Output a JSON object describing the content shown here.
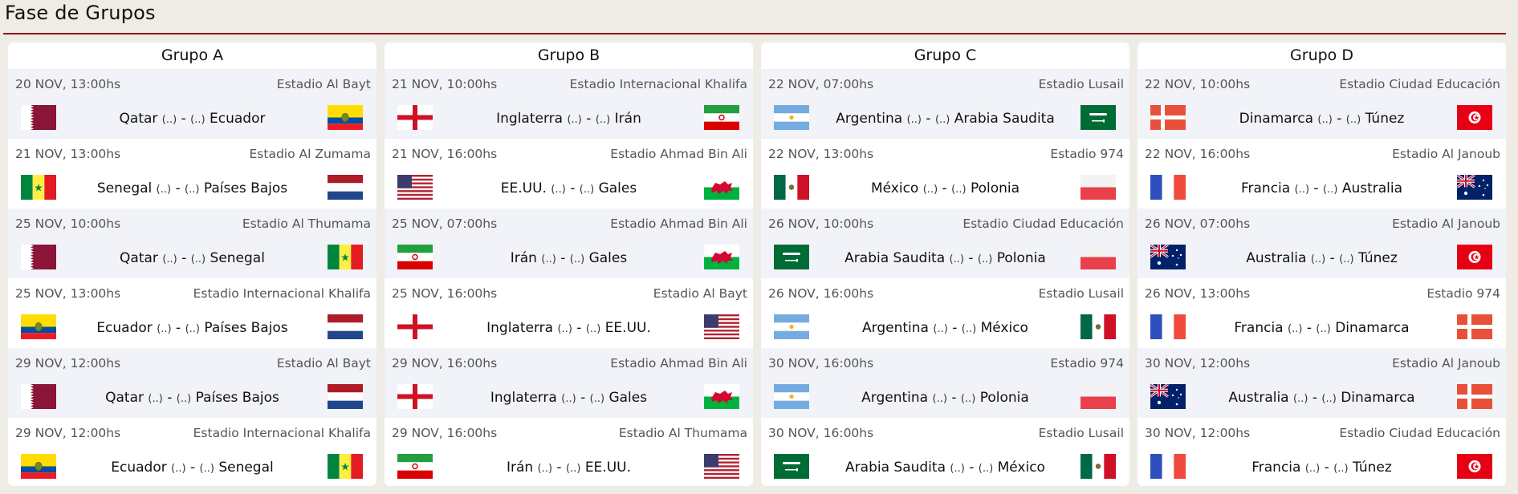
{
  "section_title": "Fase de Grupos",
  "colors": {
    "accent_rule": "#8c1a1a",
    "page_bg": "#eeece4",
    "alt_row": "#f1f3f9"
  },
  "groups": [
    {
      "title": "Grupo A",
      "matches": [
        {
          "date": "20 NOV, 13:00hs",
          "venue": "Estadio Al Bayt",
          "home": "Qatar",
          "away": "Ecuador",
          "home_score": "(..)",
          "away_score": "(..)",
          "home_flag": "qatar-flag-icon",
          "away_flag": "ecuador-flag-icon"
        },
        {
          "date": "21 NOV, 13:00hs",
          "venue": "Estadio Al Zumama",
          "home": "Senegal",
          "away": "Países Bajos",
          "home_score": "(..)",
          "away_score": "(..)",
          "home_flag": "senegal-flag-icon",
          "away_flag": "netherlands-flag-icon"
        },
        {
          "date": "25 NOV, 10:00hs",
          "venue": "Estadio Al Thumama",
          "home": "Qatar",
          "away": "Senegal",
          "home_score": "(..)",
          "away_score": "(..)",
          "home_flag": "qatar-flag-icon",
          "away_flag": "senegal-flag-icon"
        },
        {
          "date": "25 NOV, 13:00hs",
          "venue": "Estadio Internacional Khalifa",
          "home": "Ecuador",
          "away": "Países Bajos",
          "home_score": "(..)",
          "away_score": "(..)",
          "home_flag": "ecuador-flag-icon",
          "away_flag": "netherlands-flag-icon"
        },
        {
          "date": "29 NOV, 12:00hs",
          "venue": "Estadio Al Bayt",
          "home": "Qatar",
          "away": "Países Bajos",
          "home_score": "(..)",
          "away_score": "(..)",
          "home_flag": "qatar-flag-icon",
          "away_flag": "netherlands-flag-icon"
        },
        {
          "date": "29 NOV, 12:00hs",
          "venue": "Estadio Internacional Khalifa",
          "home": "Ecuador",
          "away": "Senegal",
          "home_score": "(..)",
          "away_score": "(..)",
          "home_flag": "ecuador-flag-icon",
          "away_flag": "senegal-flag-icon"
        }
      ]
    },
    {
      "title": "Grupo B",
      "matches": [
        {
          "date": "21 NOV, 10:00hs",
          "venue": "Estadio Internacional Khalifa",
          "home": "Inglaterra",
          "away": "Irán",
          "home_score": "(..)",
          "away_score": "(..)",
          "home_flag": "england-flag-icon",
          "away_flag": "iran-flag-icon"
        },
        {
          "date": "21 NOV, 16:00hs",
          "venue": "Estadio Ahmad Bin Ali",
          "home": "EE.UU.",
          "away": "Gales",
          "home_score": "(..)",
          "away_score": "(..)",
          "home_flag": "usa-flag-icon",
          "away_flag": "wales-flag-icon"
        },
        {
          "date": "25 NOV, 07:00hs",
          "venue": "Estadio Ahmad Bin Ali",
          "home": "Irán",
          "away": "Gales",
          "home_score": "(..)",
          "away_score": "(..)",
          "home_flag": "iran-flag-icon",
          "away_flag": "wales-flag-icon"
        },
        {
          "date": "25 NOV, 16:00hs",
          "venue": "Estadio Al Bayt",
          "home": "Inglaterra",
          "away": "EE.UU.",
          "home_score": "(..)",
          "away_score": "(..)",
          "home_flag": "england-flag-icon",
          "away_flag": "usa-flag-icon"
        },
        {
          "date": "29 NOV, 16:00hs",
          "venue": "Estadio Ahmad Bin Ali",
          "home": "Inglaterra",
          "away": "Gales",
          "home_score": "(..)",
          "away_score": "(..)",
          "home_flag": "england-flag-icon",
          "away_flag": "wales-flag-icon"
        },
        {
          "date": "29 NOV, 16:00hs",
          "venue": "Estadio Al Thumama",
          "home": "Irán",
          "away": "EE.UU.",
          "home_score": "(..)",
          "away_score": "(..)",
          "home_flag": "iran-flag-icon",
          "away_flag": "usa-flag-icon"
        }
      ]
    },
    {
      "title": "Grupo C",
      "matches": [
        {
          "date": "22 NOV, 07:00hs",
          "venue": "Estadio Lusail",
          "home": "Argentina",
          "away": "Arabia Saudita",
          "home_score": "(..)",
          "away_score": "(..)",
          "home_flag": "argentina-flag-icon",
          "away_flag": "saudi-arabia-flag-icon"
        },
        {
          "date": "22 NOV, 13:00hs",
          "venue": "Estadio 974",
          "home": "México",
          "away": "Polonia",
          "home_score": "(..)",
          "away_score": "(..)",
          "home_flag": "mexico-flag-icon",
          "away_flag": "poland-flag-icon"
        },
        {
          "date": "26 NOV, 10:00hs",
          "venue": "Estadio Ciudad Educación",
          "home": "Arabia Saudita",
          "away": "Polonia",
          "home_score": "(..)",
          "away_score": "(..)",
          "home_flag": "saudi-arabia-flag-icon",
          "away_flag": "poland-flag-icon"
        },
        {
          "date": "26 NOV, 16:00hs",
          "venue": "Estadio Lusail",
          "home": "Argentina",
          "away": "México",
          "home_score": "(..)",
          "away_score": "(..)",
          "home_flag": "argentina-flag-icon",
          "away_flag": "mexico-flag-icon"
        },
        {
          "date": "30 NOV, 16:00hs",
          "venue": "Estadio 974",
          "home": "Argentina",
          "away": "Polonia",
          "home_score": "(..)",
          "away_score": "(..)",
          "home_flag": "argentina-flag-icon",
          "away_flag": "poland-flag-icon"
        },
        {
          "date": "30 NOV, 16:00hs",
          "venue": "Estadio Lusail",
          "home": "Arabia Saudita",
          "away": "México",
          "home_score": "(..)",
          "away_score": "(..)",
          "home_flag": "saudi-arabia-flag-icon",
          "away_flag": "mexico-flag-icon"
        }
      ]
    },
    {
      "title": "Grupo D",
      "matches": [
        {
          "date": "22 NOV, 10:00hs",
          "venue": "Estadio Ciudad Educación",
          "home": "Dinamarca",
          "away": "Túnez",
          "home_score": "(..)",
          "away_score": "(..)",
          "home_flag": "denmark-flag-icon",
          "away_flag": "tunisia-flag-icon"
        },
        {
          "date": "22 NOV, 16:00hs",
          "venue": "Estadio Al Janoub",
          "home": "Francia",
          "away": "Australia",
          "home_score": "(..)",
          "away_score": "(..)",
          "home_flag": "france-flag-icon",
          "away_flag": "australia-flag-icon"
        },
        {
          "date": "26 NOV, 07:00hs",
          "venue": "Estadio Al Janoub",
          "home": "Australia",
          "away": "Túnez",
          "home_score": "(..)",
          "away_score": "(..)",
          "home_flag": "australia-flag-icon",
          "away_flag": "tunisia-flag-icon"
        },
        {
          "date": "26 NOV, 13:00hs",
          "venue": "Estadio 974",
          "home": "Francia",
          "away": "Dinamarca",
          "home_score": "(..)",
          "away_score": "(..)",
          "home_flag": "france-flag-icon",
          "away_flag": "denmark-flag-icon"
        },
        {
          "date": "30 NOV, 12:00hs",
          "venue": "Estadio Al Janoub",
          "home": "Australia",
          "away": "Dinamarca",
          "home_score": "(..)",
          "away_score": "(..)",
          "home_flag": "australia-flag-icon",
          "away_flag": "denmark-flag-icon"
        },
        {
          "date": "30 NOV, 12:00hs",
          "venue": "Estadio Ciudad Educación",
          "home": "Francia",
          "away": "Túnez",
          "home_score": "(..)",
          "away_score": "(..)",
          "home_flag": "france-flag-icon",
          "away_flag": "tunisia-flag-icon"
        }
      ]
    }
  ]
}
